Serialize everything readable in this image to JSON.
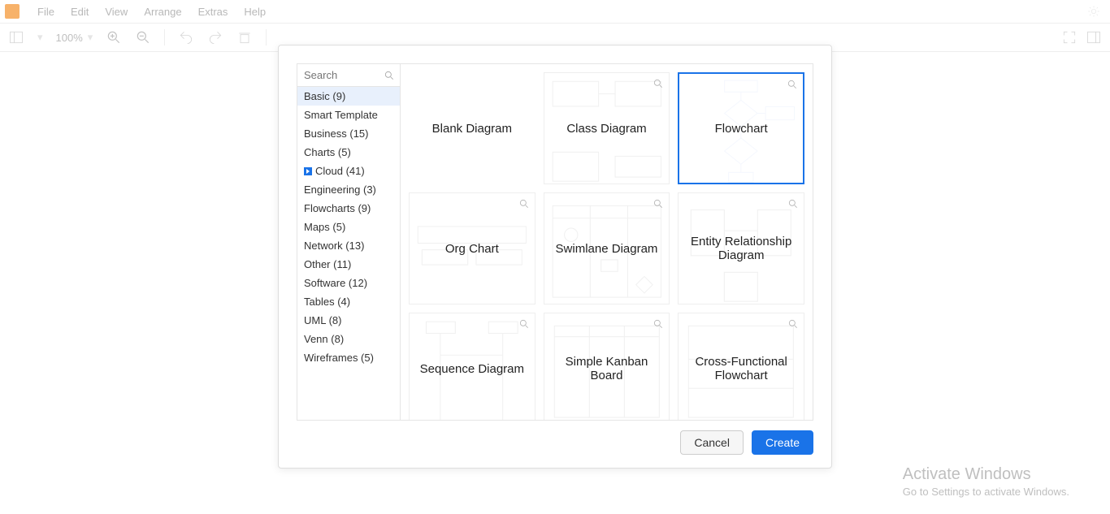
{
  "menu": {
    "items": [
      "File",
      "Edit",
      "View",
      "Arrange",
      "Extras",
      "Help"
    ]
  },
  "toolbar": {
    "zoom": "100%"
  },
  "dialog": {
    "search_placeholder": "Search",
    "categories": [
      {
        "label": "Basic (9)",
        "selected": true
      },
      {
        "label": "Smart Template"
      },
      {
        "label": "Business (15)"
      },
      {
        "label": "Charts (5)"
      },
      {
        "label": "Cloud (41)",
        "expander": true
      },
      {
        "label": "Engineering (3)"
      },
      {
        "label": "Flowcharts (9)"
      },
      {
        "label": "Maps (5)"
      },
      {
        "label": "Network (13)"
      },
      {
        "label": "Other (11)"
      },
      {
        "label": "Software (12)"
      },
      {
        "label": "Tables (4)"
      },
      {
        "label": "UML (8)"
      },
      {
        "label": "Venn (8)"
      },
      {
        "label": "Wireframes (5)"
      }
    ],
    "templates": [
      {
        "label": "Blank Diagram",
        "plain": true
      },
      {
        "label": "Class Diagram",
        "deco": "class"
      },
      {
        "label": "Flowchart",
        "selected": true,
        "deco": "flow"
      },
      {
        "label": "Org Chart",
        "deco": "org"
      },
      {
        "label": "Swimlane Diagram",
        "deco": "swim"
      },
      {
        "label": "Entity Relationship Diagram",
        "deco": "er"
      },
      {
        "label": "Sequence Diagram",
        "deco": "seq"
      },
      {
        "label": "Simple Kanban Board",
        "deco": "kanban"
      },
      {
        "label": "Cross-Functional Flowchart",
        "deco": "cross"
      }
    ],
    "cancel": "Cancel",
    "create": "Create"
  },
  "activate": {
    "line1": "Activate Windows",
    "line2": "Go to Settings to activate Windows."
  }
}
